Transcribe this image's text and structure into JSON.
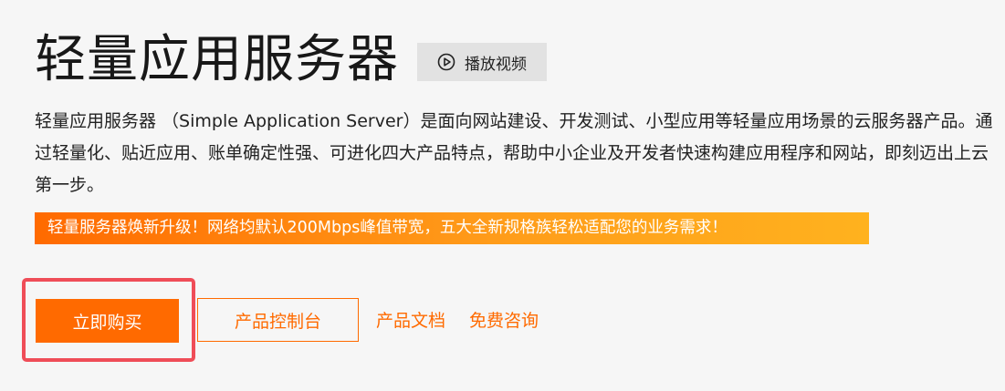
{
  "product": {
    "title": "轻量应用服务器",
    "video_button_label": "播放视频",
    "video_icon": "play-circle-icon",
    "description": "轻量应用服务器 （Simple Application Server）是面向网站建设、开发测试、小型应用等轻量应用场景的云服务器产品。通过轻量化、贴近应用、账单确定性强、可进化四大产品特点，帮助中小企业及开发者快速构建应用程序和网站，即刻迈出上云第一步。",
    "promo_banner": "轻量服务器焕新升级！网络均默认200Mbps峰值带宽，五大全新规格族轻松适配您的业务需求！"
  },
  "actions": {
    "buy_label": "立即购买",
    "console_label": "产品控制台",
    "docs_label": "产品文档",
    "consult_label": "免费咨询"
  },
  "colors": {
    "accent": "#ff6a00",
    "highlight_border": "#ef4d58",
    "background": "#f6f6f6",
    "video_button_bg": "#e2e2e2"
  }
}
